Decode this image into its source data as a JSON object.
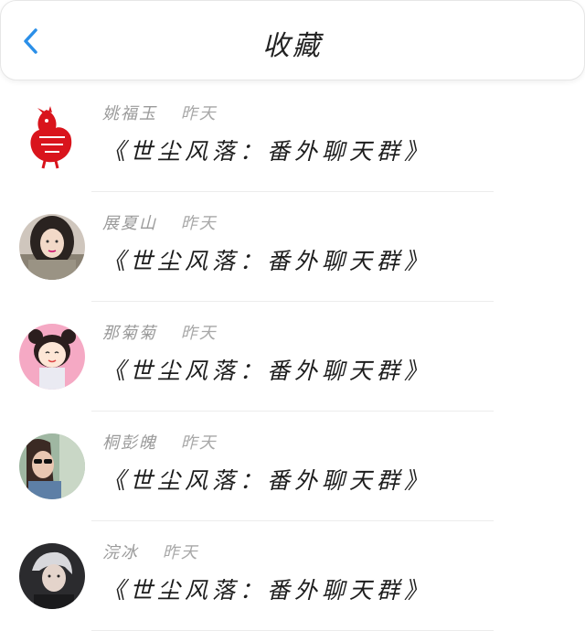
{
  "header": {
    "title": "收藏",
    "back_icon": "chevron-left-icon",
    "accent_color": "#2b8fe8"
  },
  "favorites": [
    {
      "name": "姚福玉",
      "time": "昨天",
      "message": "《世尘风落：番外聊天群》",
      "avatar": "red-paper-cut-rooster-icon"
    },
    {
      "name": "展夏山",
      "time": "昨天",
      "message": "《世尘风落：番外聊天群》",
      "avatar": "girl-photo-avatar"
    },
    {
      "name": "那菊菊",
      "time": "昨天",
      "message": "《世尘风落：番外聊天群》",
      "avatar": "cartoon-girl-avatar"
    },
    {
      "name": "桐彭魄",
      "time": "昨天",
      "message": "《世尘风落：番外聊天群》",
      "avatar": "girl-sunglasses-photo-avatar"
    },
    {
      "name": "浣冰",
      "time": "昨天",
      "message": "《世尘风落：番外聊天群》",
      "avatar": "boy-photo-avatar"
    }
  ]
}
